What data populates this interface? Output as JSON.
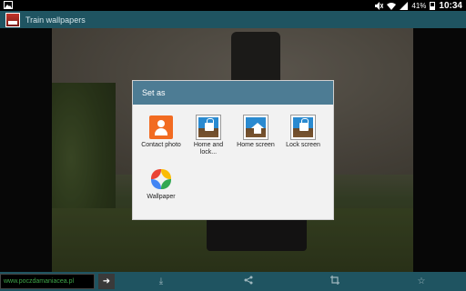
{
  "status_bar": {
    "battery": "41%",
    "time": "10:34",
    "icons": [
      "image-notification-icon",
      "mute-icon",
      "wifi-icon",
      "signal-icon",
      "battery-icon"
    ]
  },
  "action_bar": {
    "title": "Train wallpapers",
    "app_icon": "app-icon"
  },
  "dialog": {
    "title": "Set as",
    "options": [
      {
        "label": "Contact photo",
        "icon": "contact-icon"
      },
      {
        "label": "Home and lock...",
        "icon": "home-and-lock-icon"
      },
      {
        "label": "Home screen",
        "icon": "home-screen-icon"
      },
      {
        "label": "Lock screen",
        "icon": "lock-screen-icon"
      },
      {
        "label": "Wallpaper",
        "icon": "photos-icon"
      }
    ]
  },
  "bottom_bar": {
    "url": "www.poczdamaniacea.pl",
    "go_icon": "arrow-right-icon",
    "icons": [
      "download-icon",
      "share-icon",
      "crop-icon",
      "star-icon"
    ]
  },
  "colors": {
    "action_bar": "#1f5461",
    "dialog_header": "#4d7c94",
    "contact_tile": "#f26b21"
  }
}
